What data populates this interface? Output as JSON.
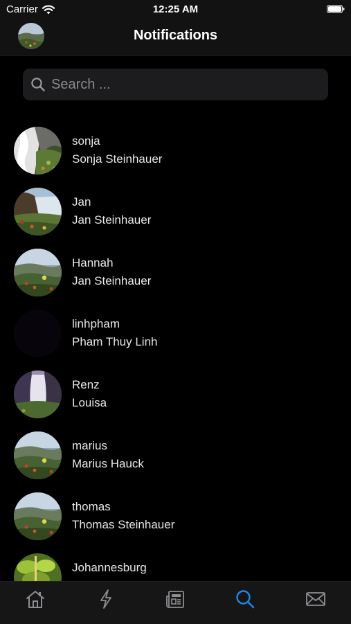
{
  "status_bar": {
    "carrier": "Carrier",
    "time": "12:25 AM"
  },
  "nav": {
    "title": "Notifications"
  },
  "search": {
    "placeholder": "Search ..."
  },
  "users": [
    {
      "username": "sonja",
      "full_name": "Sonja Steinhauer",
      "avatar": "waterfall-bw"
    },
    {
      "username": "Jan",
      "full_name": "Jan Steinhauer",
      "avatar": "waterfall-cliff"
    },
    {
      "username": "Hannah",
      "full_name": "Jan Steinhauer",
      "avatar": "meadow"
    },
    {
      "username": "linhpham",
      "full_name": "Pham Thuy Linh",
      "avatar": "empty"
    },
    {
      "username": "Renz",
      "full_name": "Louisa",
      "avatar": "waterfall-purple"
    },
    {
      "username": "marius",
      "full_name": "Marius Hauck",
      "avatar": "meadow"
    },
    {
      "username": "thomas",
      "full_name": "Thomas Steinhauer",
      "avatar": "meadow"
    },
    {
      "username": "Johannesburg",
      "full_name": "",
      "avatar": "leaves"
    }
  ],
  "tabs": [
    {
      "name": "home-icon",
      "active": false
    },
    {
      "name": "activity-icon",
      "active": false
    },
    {
      "name": "news-icon",
      "active": false
    },
    {
      "name": "search-icon",
      "active": true
    },
    {
      "name": "mail-icon",
      "active": false
    }
  ],
  "colors": {
    "accent": "#1e88e5",
    "tab_inactive": "#8e8e93",
    "background": "#000000"
  }
}
